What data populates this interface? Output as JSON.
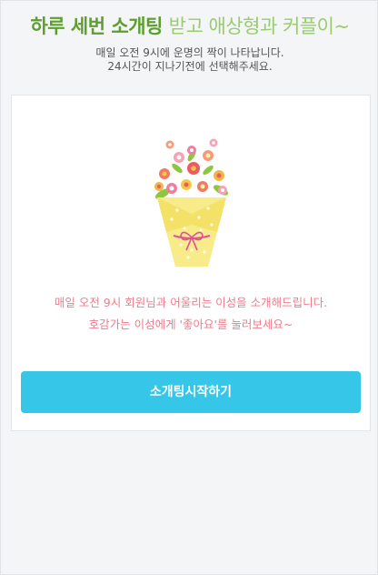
{
  "header": {
    "headline_part1": "하루 세번 소개팅",
    "headline_part2": "받고 애상형과 커플이~",
    "subtitle_line1": "매일 오전 9시에 운명의 짝이 나타납니다.",
    "subtitle_line2": "24시간이 지나기전에 선택해주세요."
  },
  "card": {
    "illustration": "flower-bouquet-icon",
    "message_line1": "매일 오전 9시 회원님과 어울리는 이성을 소개해드립니다.",
    "message_line2": "호감가는 이성에게 '좋아요'를 눌러보세요~",
    "start_button_label": "소개팅시작하기"
  },
  "colors": {
    "headline_dark_green": "#5e9e2f",
    "headline_light_green": "#9acb6f",
    "message_pink": "#ef7b8c",
    "button_blue": "#35c6e8"
  }
}
